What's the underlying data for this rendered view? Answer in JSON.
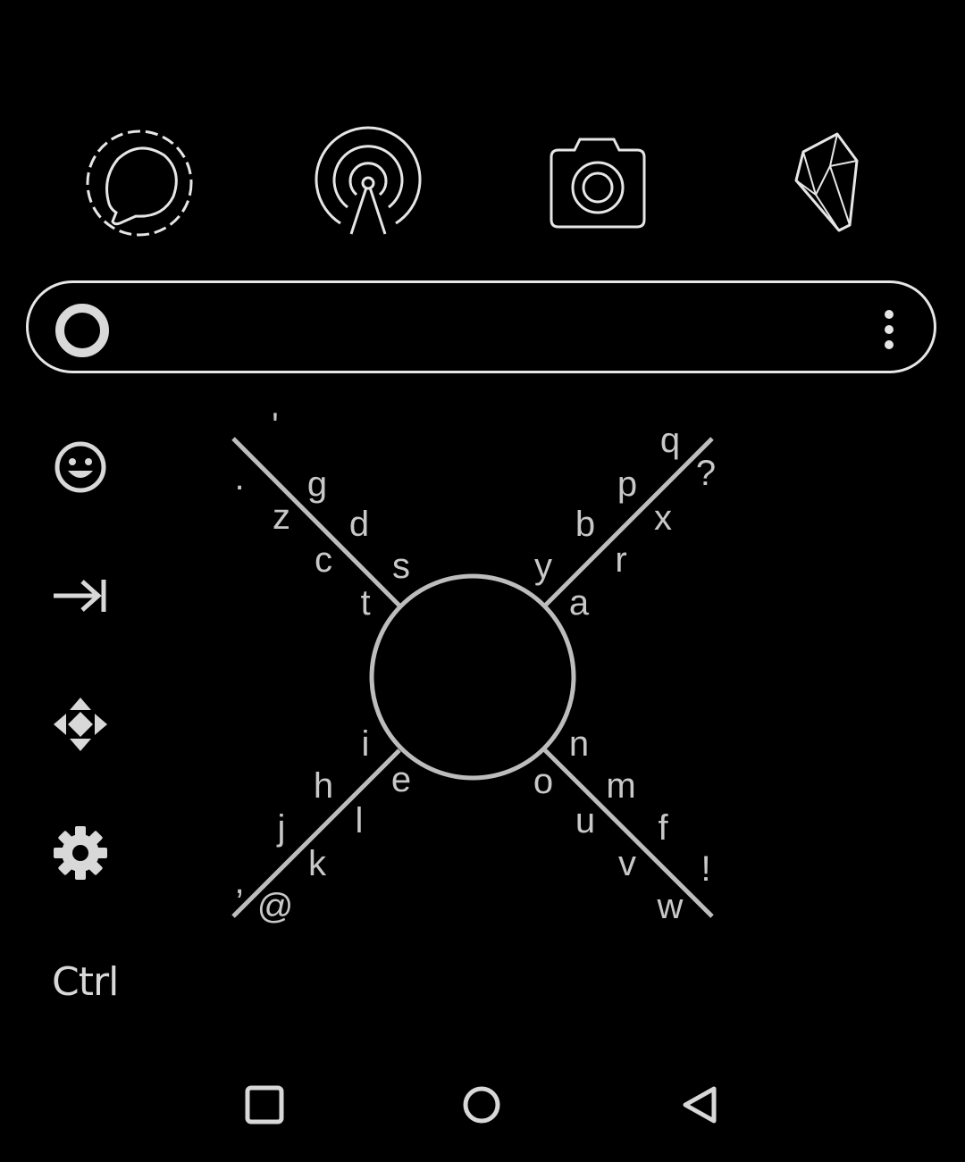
{
  "apps": [
    {
      "name": "signal-icon"
    },
    {
      "name": "podcast-icon"
    },
    {
      "name": "camera-icon"
    },
    {
      "name": "obsidian-icon"
    }
  ],
  "search_bar": {
    "logo": "circle-logo-icon",
    "menu": "more-vertical-icon"
  },
  "side_toolbar": {
    "items": [
      "emoji-icon",
      "tab-icon",
      "move-cursor-icon",
      "settings-icon"
    ],
    "ctrl_label": "Ctrl"
  },
  "keyboard": {
    "type": "8pen",
    "keys": [
      "'",
      ".",
      "g",
      "z",
      "d",
      "c",
      "s",
      "t",
      "q",
      "?",
      "p",
      "x",
      "b",
      "r",
      "y",
      "a",
      "i",
      "h",
      "e",
      "j",
      "l",
      "k",
      ",",
      "@",
      "n",
      "o",
      "m",
      "u",
      "f",
      "v",
      "!",
      "w"
    ]
  },
  "navigation_bar": {
    "buttons": [
      "recents-button",
      "home-button",
      "back-button"
    ]
  },
  "colors": {
    "background": "#000000",
    "foreground": "#e6e6e6",
    "key_text": "#c8c8c8"
  }
}
